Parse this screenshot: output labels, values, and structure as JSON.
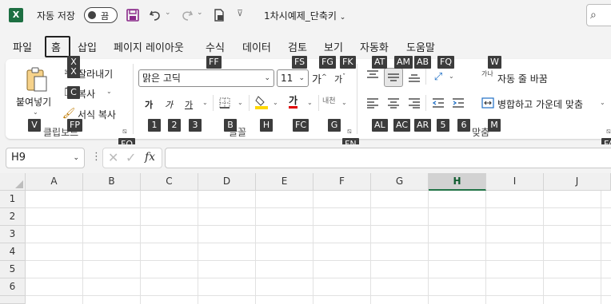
{
  "titlebar": {
    "logo": "X",
    "autosave_label": "자동 저장",
    "autosave_state": "끔",
    "doc_title": "1차시예제_단축키",
    "search_icon": "⌕"
  },
  "tabs": [
    {
      "label": "파일"
    },
    {
      "label": "홈"
    },
    {
      "label": "삽입"
    },
    {
      "label": "페이지 레이아웃"
    },
    {
      "label": "수식"
    },
    {
      "label": "데이터"
    },
    {
      "label": "검토"
    },
    {
      "label": "보기"
    },
    {
      "label": "자동화"
    },
    {
      "label": "도움말"
    }
  ],
  "ribbon": {
    "clipboard": {
      "paste_label": "붙여넣기",
      "cut_label": "잘라내기",
      "copy_label": "복사",
      "format_painter_label": "서식 복사",
      "group_label": "클립보드"
    },
    "font": {
      "font_name": "맑은 고딕",
      "font_size": "11",
      "grow_label": "가",
      "shrink_label": "가",
      "bold_label": "가",
      "italic_label": "가",
      "underline_label": "가",
      "font_color_label": "가",
      "phonetic_label": "내천",
      "group_label": "글꼴"
    },
    "alignment": {
      "wrap_text_label": "자동 줄 바꿈",
      "wrap_icon_label": "가나",
      "merge_label": "병합하고 가운데 맞춤",
      "group_label": "맞춤"
    }
  },
  "keytips": {
    "home": "X",
    "paste": "V",
    "cut": "X",
    "copy": "C",
    "format_painter": "FP",
    "clipboard_launcher": "FO",
    "font_name": "FF",
    "font_size": "FS",
    "grow": "FG",
    "shrink": "FK",
    "bold": "1",
    "italic": "2",
    "underline": "3",
    "borders": "B",
    "fill": "H",
    "font_color": "FC",
    "phonetic": "G",
    "font_launcher": "FN",
    "align_top": "AT",
    "align_middle": "AM",
    "align_bottom": "AB",
    "orientation": "FQ",
    "wrap": "W",
    "align_left": "AL",
    "align_center": "AC",
    "align_right": "AR",
    "decrease_indent": "5",
    "increase_indent": "6",
    "merge": "M",
    "alignment_launcher": "FA"
  },
  "formula_bar": {
    "name_box": "H9",
    "fx_label": "fx",
    "value": ""
  },
  "grid": {
    "columns": [
      "A",
      "B",
      "C",
      "D",
      "E",
      "F",
      "G",
      "H",
      "I",
      "J"
    ],
    "selected_column": "H",
    "rows": [
      "1",
      "2",
      "3",
      "4",
      "5",
      "6"
    ]
  },
  "colors": {
    "accent": "#217346",
    "purple": "#8a2a8a",
    "font_color_red": "#e00000",
    "fill_yellow": "#ffd800"
  }
}
